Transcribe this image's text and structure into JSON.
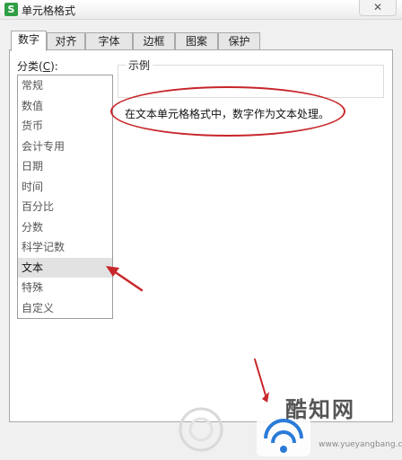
{
  "window": {
    "app_icon": "S",
    "title": "单元格格式",
    "close_glyph": "✕"
  },
  "tabs": [
    {
      "label": "数字",
      "active": true
    },
    {
      "label": "对齐",
      "active": false
    },
    {
      "label": "字体",
      "active": false
    },
    {
      "label": "边框",
      "active": false
    },
    {
      "label": "图案",
      "active": false
    },
    {
      "label": "保护",
      "active": false
    }
  ],
  "category": {
    "label_prefix": "分类(",
    "label_accel": "C",
    "label_suffix": "):",
    "items": [
      "常规",
      "数值",
      "货币",
      "会计专用",
      "日期",
      "时间",
      "百分比",
      "分数",
      "科学记数",
      "文本",
      "特殊",
      "自定义"
    ],
    "selected_index": 9
  },
  "sample": {
    "label": "示例"
  },
  "description": "在文本单元格格式中，数字作为文本处理。",
  "annotation_color": "#c8262a",
  "watermark": {
    "brand_text": "酷知网",
    "url_text": "www.yueyangbang.com"
  }
}
